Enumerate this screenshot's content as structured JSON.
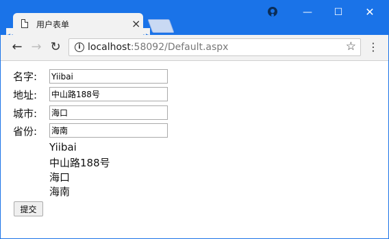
{
  "browser": {
    "tab_title": "用户表单",
    "url_host": "localhost",
    "url_port_path": ":58092/Default.aspx",
    "win_min": "—",
    "win_max": "☐",
    "win_close": "✕",
    "tab_close": "×",
    "back": "←",
    "forward": "→",
    "reload": "↻",
    "info": "i",
    "star": "☆",
    "menu": "⋮"
  },
  "form": {
    "fields": [
      {
        "label": "名字:",
        "value": "Yiibai"
      },
      {
        "label": "地址:",
        "value": "中山路188号"
      },
      {
        "label": "城市:",
        "value": "海口"
      },
      {
        "label": "省份:",
        "value": "海南"
      }
    ],
    "output_lines": [
      "Yiibai",
      "中山路188号",
      "海口",
      "海南"
    ],
    "submit_label": "提交"
  }
}
